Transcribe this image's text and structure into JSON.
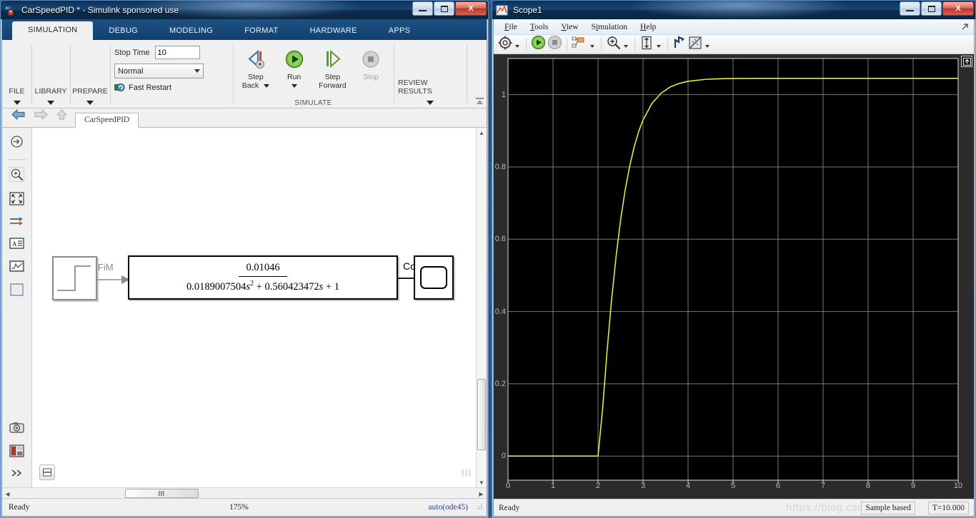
{
  "simulink_window": {
    "title": "CarSpeedPID * - Simulink sponsored use",
    "app_icon": "simulink-icon",
    "window_buttons": {
      "minimize": "minimize-icon",
      "maximize": "maximize-icon",
      "close": "X"
    },
    "tabs": [
      {
        "label": "SIMULATION",
        "active": true
      },
      {
        "label": "DEBUG",
        "active": false
      },
      {
        "label": "MODELING",
        "active": false
      },
      {
        "label": "FORMAT",
        "active": false
      },
      {
        "label": "HARDWARE",
        "active": false
      },
      {
        "label": "APPS",
        "active": false
      }
    ],
    "ribbon": {
      "file_group": "FILE",
      "library_group": "LIBRARY",
      "prepare_group": "PREPARE",
      "stop_time_label": "Stop Time",
      "stop_time_value": "10",
      "sim_mode_value": "Normal",
      "fast_restart_label": "Fast Restart",
      "step_back_label": "Step\nBack",
      "step_back_line1": "Step",
      "step_back_line2": "Back",
      "run_label": "Run",
      "step_forward_line1": "Step",
      "step_forward_line2": "Forward",
      "stop_label": "Stop",
      "review_results_group": "REVIEW RESULTS",
      "simulate_caption": "SIMULATE"
    },
    "breadcrumb": {
      "back": "back-arrow-icon",
      "forward": "forward-arrow-icon",
      "up": "up-arrow-icon",
      "model_name": "CarSpeedPID"
    },
    "left_toolbar": [
      "navigate-icon",
      "zoom-in-icon",
      "fit-to-view-icon",
      "signal-routing-icon",
      "annotation-icon",
      "scope-viewer-icon",
      "subsystem-icon",
      "camera-icon",
      "layout-icon",
      "more-icon"
    ],
    "model": {
      "step_block": {
        "name": "step-block",
        "icon": "step-signal-icon"
      },
      "signal_in_label": "FiM",
      "transfer_fcn": {
        "numerator": "0.01046",
        "denominator_a": "0.0189007504",
        "denominator_s2": "s",
        "denominator_sup": "2",
        "denominator_b": " + 0.560423472",
        "denominator_s": "s",
        "denominator_c": " + 1"
      },
      "signal_out_label": "Co",
      "scope_block": {
        "name": "scope-block"
      },
      "collapse_button": "collapse-canvas-icon"
    },
    "status_bar": {
      "state": "Ready",
      "zoom": "175%",
      "solver": "auto(ode45)"
    }
  },
  "scope_window": {
    "title": "Scope1",
    "app_icon": "matlab-icon",
    "window_buttons": {
      "minimize": "minimize-icon",
      "maximize": "maximize-icon",
      "close": "X"
    },
    "menus": [
      {
        "label": "File",
        "mnemonic": "F"
      },
      {
        "label": "Tools",
        "mnemonic": "T"
      },
      {
        "label": "View",
        "mnemonic": "V"
      },
      {
        "label": "Simulation",
        "mnemonic": "i"
      },
      {
        "label": "Help",
        "mnemonic": "H"
      }
    ],
    "menubar_corner": "undock-icon",
    "toolbar": [
      "configuration-properties-icon",
      "run-icon",
      "stop-icon",
      "signal-selection-icon",
      "zoom-in-icon",
      "autoscale-icon",
      "cursor-measurements-icon",
      "measurements-icon"
    ],
    "plot_corner_button": "legend-toggle-icon",
    "status_bar": {
      "state": "Ready",
      "frame_mode": "Sample based",
      "time": "T=10.000"
    },
    "watermark": "https://blog.csdn.net"
  },
  "chart_data": {
    "type": "line",
    "title": "",
    "xlabel": "",
    "ylabel": "",
    "xlim": [
      0,
      10
    ],
    "ylim": [
      -0.0667,
      1.1
    ],
    "xticks": [
      0,
      1,
      2,
      3,
      4,
      5,
      6,
      7,
      8,
      9,
      10
    ],
    "yticks": [
      0,
      0.2,
      0.4,
      0.6,
      0.8,
      1
    ],
    "grid": true,
    "legend": "none",
    "background": "#000000",
    "line_color": "#e8e83c",
    "grid_color": "#8c8c8c",
    "axis_bg": "#2b2b2b",
    "tick_color": "#bbbbbb",
    "series": [
      {
        "name": "Co",
        "description": "Step response of 0.01046 / (0.0189007504 s^2 + 0.560423472 s + 1), step at t=2, steady state 1.045",
        "x": [
          0,
          0.5,
          1.0,
          1.5,
          2.0,
          2.1,
          2.2,
          2.3,
          2.4,
          2.5,
          2.6,
          2.7,
          2.8,
          2.9,
          3.0,
          3.2,
          3.4,
          3.6,
          3.8,
          4.0,
          4.4,
          4.8,
          5.2,
          5.6,
          6.0,
          7.0,
          8.0,
          9.0,
          10.0
        ],
        "y": [
          0,
          0,
          0,
          0,
          0,
          0.128,
          0.289,
          0.431,
          0.551,
          0.652,
          0.734,
          0.8,
          0.854,
          0.897,
          0.93,
          0.976,
          1.004,
          1.021,
          1.031,
          1.037,
          1.0425,
          1.0443,
          1.0448,
          1.045,
          1.045,
          1.045,
          1.045,
          1.045,
          1.045
        ]
      }
    ]
  }
}
